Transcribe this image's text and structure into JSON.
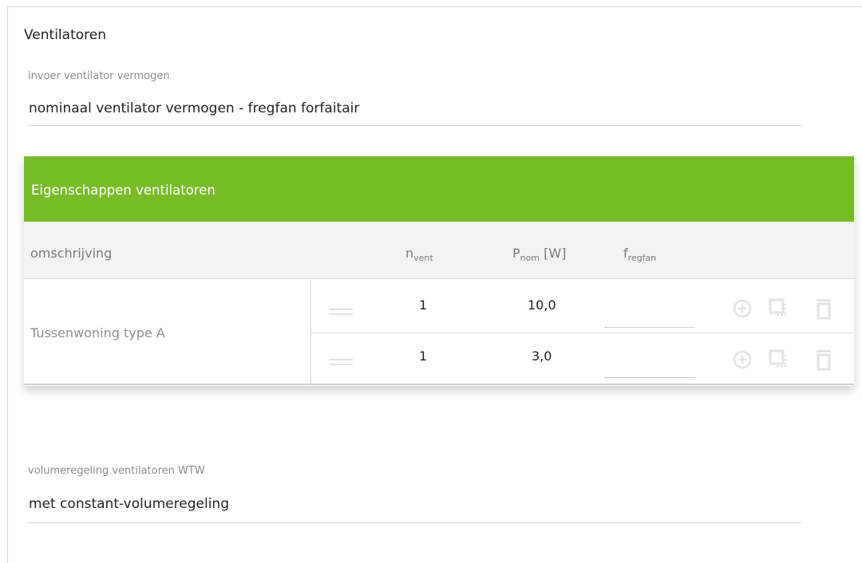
{
  "section": {
    "title": "Ventilatoren"
  },
  "fields": {
    "input_power": {
      "label": "invoer ventilator vermogen",
      "value": "nominaal ventilator vermogen - fregfan forfaitair"
    },
    "volume_control": {
      "label": "volumeregeling ventilatoren WTW",
      "value": "met constant-volumeregeling"
    }
  },
  "table": {
    "title": "Eigenschappen ventilatoren",
    "columns": {
      "description": "omschrijving",
      "n_main": "n",
      "n_sub": "vent",
      "p_main": "P",
      "p_sub": "nom",
      "p_unit": " [W]",
      "f_main": "f",
      "f_sub": "regfan"
    },
    "group_label": "Tussenwoning type A",
    "rows": [
      {
        "n": "1",
        "p": "10,0",
        "f": ""
      },
      {
        "n": "1",
        "p": "3,0",
        "f": ""
      }
    ]
  },
  "icons": {
    "add": "plus-circle-icon",
    "copy": "copy-icon",
    "delete": "trash-icon"
  },
  "colors": {
    "header_bg": "#77bc27",
    "header_text": "#ffffff",
    "icon": "#e2e2e2"
  }
}
